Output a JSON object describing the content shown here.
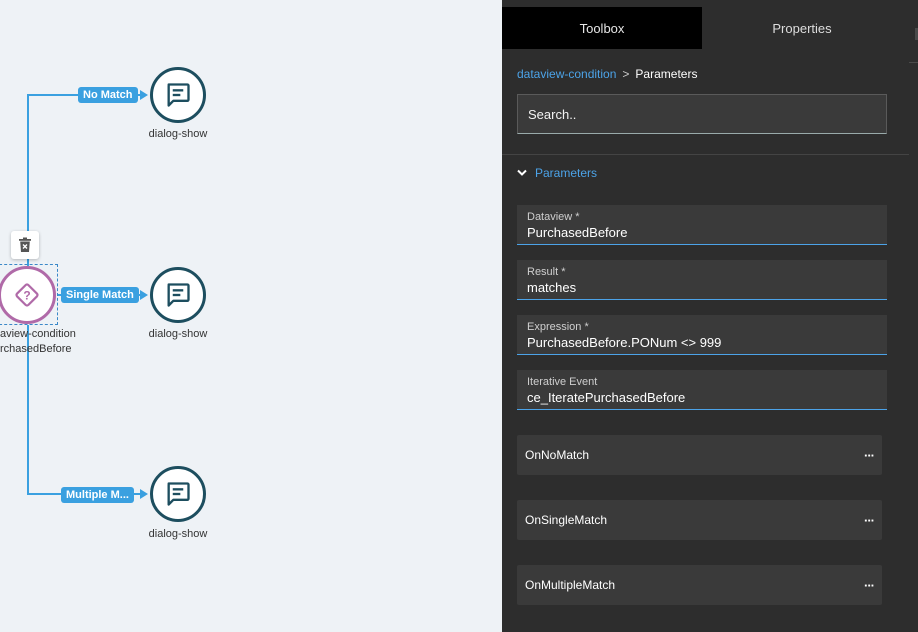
{
  "canvas": {
    "edges": [
      {
        "label": "No Match"
      },
      {
        "label": "Single Match"
      },
      {
        "label": "Multiple M..."
      }
    ],
    "nodes": [
      {
        "label": "dialog-show",
        "icon": "chat-message-icon"
      },
      {
        "label": "dialog-show",
        "icon": "chat-message-icon"
      },
      {
        "label": "dialog-show",
        "icon": "chat-message-icon"
      }
    ],
    "condition": {
      "label_line1": "aview-condition",
      "label_line2": "rchasedBefore",
      "icon": "diamond-question-icon"
    },
    "delete_icon": "trash-icon"
  },
  "panel": {
    "tabs": [
      {
        "label": "Toolbox",
        "active": true
      },
      {
        "label": "Properties",
        "active": false
      }
    ],
    "breadcrumb": {
      "link": "dataview-condition",
      "separator": ">",
      "current": "Parameters"
    },
    "search": {
      "placeholder": "Search.."
    },
    "section": {
      "title": "Parameters",
      "expanded": true
    },
    "fields": [
      {
        "label": "Dataview *",
        "value": "PurchasedBefore"
      },
      {
        "label": "Result *",
        "value": "matches"
      },
      {
        "label": "Expression *",
        "value": "PurchasedBefore.PONum <> 999"
      },
      {
        "label": "Iterative Event",
        "value": "ce_IteratePurchasedBefore"
      }
    ],
    "events": [
      {
        "name": "OnNoMatch",
        "more": "···"
      },
      {
        "name": "OnSingleMatch",
        "more": "···"
      },
      {
        "name": "OnMultipleMatch",
        "more": "···"
      }
    ]
  },
  "colors": {
    "accent": "#3aa0e0",
    "link": "#4ca3e8",
    "panel_bg": "#2d2d2d",
    "node_border": "#1d4e5f",
    "condition_border": "#b06aa8"
  }
}
